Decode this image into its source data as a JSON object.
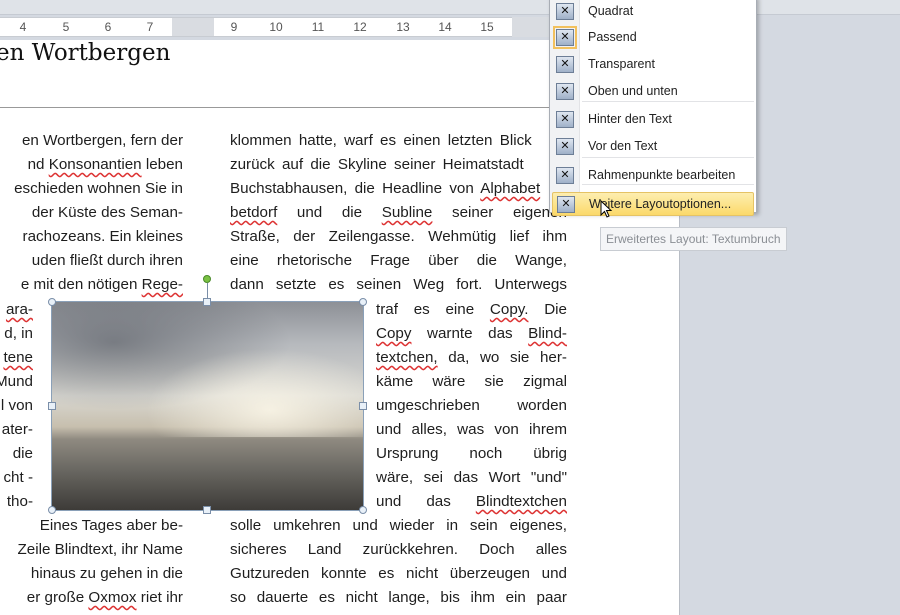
{
  "ruler": {
    "ticks": [
      "4",
      "5",
      "6",
      "7",
      "9",
      "10",
      "11",
      "12",
      "13",
      "14",
      "15"
    ]
  },
  "document": {
    "heading": "en Wortbergen",
    "left_lines": [
      "en Wortbergen, fern der",
      "nd Konsonantien leben",
      "eschieden wohnen Sie in",
      "der Küste des Seman-",
      "rachozeans. Ein kleines",
      "uden fließt durch ihren",
      "e mit den nötigen Rege-",
      "ara-",
      "d, in",
      "tene",
      "Mund",
      "l von",
      "ater-",
      "die",
      "cht -",
      "tho-",
      "Eines Tages aber be-",
      "Zeile Blindtext, ihr Name",
      "hinaus zu gehen in die",
      "er große Oxmox riet ihr"
    ],
    "right_lines": [
      "klommen hatte, warf es einen letzten Blick",
      "zurück auf die Skyline seiner Heimatstadt",
      "Buchstabhausen, die Headline von Alphabet",
      "betdorf und die Subline seiner eigenen",
      "Straße, der Zeilengasse. Wehmütig lief ihm",
      "eine rhetorische Frage über die Wange,",
      "dann setzte es seinen Weg fort. Unterwegs",
      "traf es eine Copy. Die",
      "Copy warnte das Blind-",
      "textchen, da, wo sie her-",
      "käme wäre sie zigmal",
      "umgeschrieben worden",
      "und alles, was von ihrem",
      "Ursprung noch übrig",
      "wäre, sei das Wort \"und\"",
      "und das Blindtextchen",
      "solle umkehren und wieder in sein eigenes,",
      "sicheres Land zurückkehren. Doch alles",
      "Gutzureden konnte es nicht überzeugen und",
      "so dauerte es nicht lange, bis ihm ein paar"
    ]
  },
  "context_menu": {
    "items": [
      {
        "label": "Quadrat",
        "icon": "wrap-square-icon"
      },
      {
        "label": "Passend",
        "icon": "wrap-tight-icon",
        "checked": true
      },
      {
        "label": "Transparent",
        "icon": "wrap-through-icon"
      },
      {
        "label": "Oben und unten",
        "icon": "wrap-top-bottom-icon"
      },
      {
        "label": "Hinter den Text",
        "icon": "behind-text-icon"
      },
      {
        "label": "Vor den Text",
        "icon": "in-front-of-text-icon"
      },
      {
        "label": "Rahmenpunkte bearbeiten",
        "icon": "edit-wrap-points-icon"
      },
      {
        "label": "Weitere Layoutoptionen...",
        "icon": "more-layout-options-icon",
        "highlighted": true
      }
    ]
  },
  "tooltip": "Erweitertes Layout: Textumbruch",
  "colors": {
    "highlight": "#fbd96a",
    "spellcheck": "#dd3333"
  }
}
